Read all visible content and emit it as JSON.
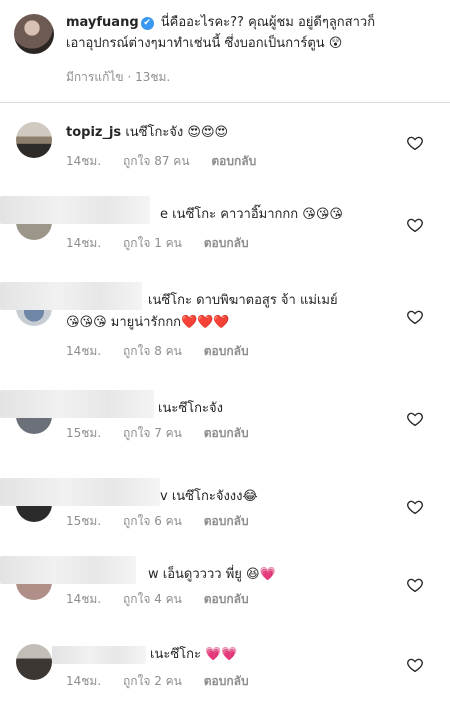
{
  "caption": {
    "username": "mayfuang",
    "verified_icon": "✔",
    "line1": "นี่คืออะไรคะ?? คุณผู้ชม อยู่ดีๆลูกสาวก็",
    "line2": "เอาอุปกรณ์ต่างๆมาทำเช่นนี้ ซึ่งบอกเป็นการ์ตูน 😲",
    "edited": "มีการแก้ไข",
    "time": "13ชม."
  },
  "comments": [
    {
      "username": "topiz_js",
      "text": "เนซึโกะจัง 😍😍😍",
      "text2": "",
      "time": "14ชม.",
      "likes": "ถูกใจ 87 คน",
      "reply": "ตอบกลับ",
      "heart_icon": "heart-outline"
    },
    {
      "username": "",
      "tail": "e",
      "text": "เนซึโกะ คาวาอิ๊มากกก 😘😘😘",
      "text2": "",
      "time": "14ชม.",
      "likes": "ถูกใจ 1 คน",
      "reply": "ตอบกลับ",
      "heart_icon": "heart-outline"
    },
    {
      "username": "",
      "tail": "",
      "text": "เนซึโกะ ดาบพิฆาตอสูร จ้า แม่เมย์",
      "text2": "😘😘😘 มายูน่ารักกก❤️❤️❤️",
      "time": "14ชม.",
      "likes": "ถูกใจ 8 คน",
      "reply": "ตอบกลับ",
      "heart_icon": "heart-outline"
    },
    {
      "username": "",
      "tail": "",
      "text": "เนะซึโกะจัง",
      "text2": "",
      "time": "15ชม.",
      "likes": "ถูกใจ 7 คน",
      "reply": "ตอบกลับ",
      "heart_icon": "heart-outline"
    },
    {
      "username": "",
      "tail": "v",
      "text": "เนซึโกะจังงง😂",
      "text2": "",
      "time": "15ชม.",
      "likes": "ถูกใจ 6 คน",
      "reply": "ตอบกลับ",
      "heart_icon": "heart-outline"
    },
    {
      "username": "",
      "tail": "w",
      "text": "เอ็นดูวววว พี่ยู 😆💗",
      "text2": "",
      "time": "14ชม.",
      "likes": "ถูกใจ 4 คน",
      "reply": "ตอบกลับ",
      "heart_icon": "heart-outline"
    },
    {
      "username": "",
      "tail": "",
      "text": "เนะซึโกะ 💗💗",
      "text2": "",
      "time": "14ชม.",
      "likes": "ถูกใจ 2 คน",
      "reply": "ตอบกลับ",
      "heart_icon": "heart-outline"
    }
  ]
}
